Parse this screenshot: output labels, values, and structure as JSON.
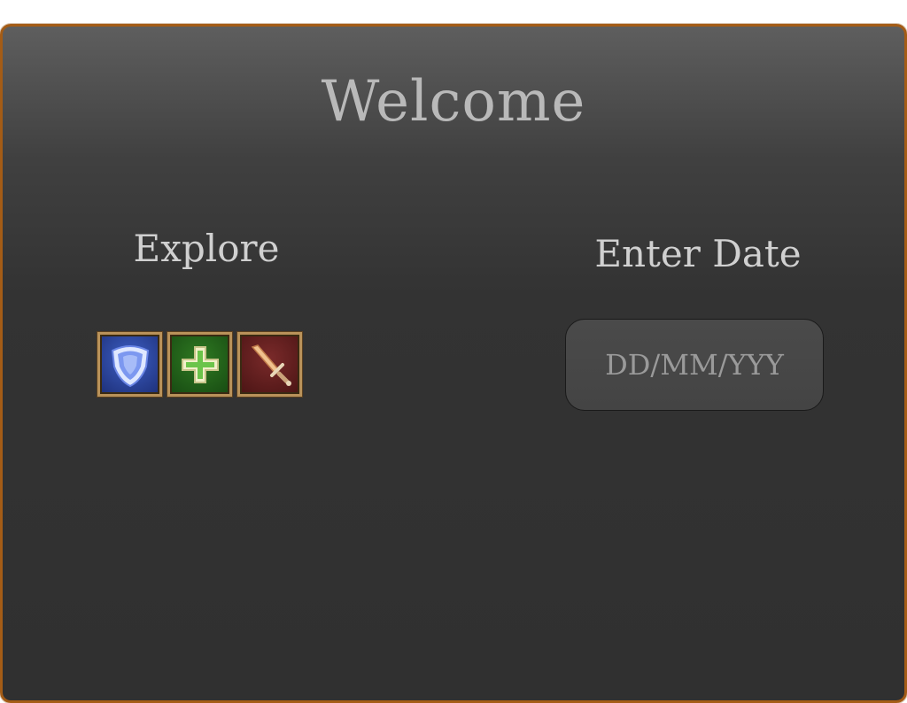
{
  "page": {
    "title": "Welcome"
  },
  "explore": {
    "label": "Explore",
    "icons": [
      {
        "name": "shield-icon",
        "color": "#2c46a8"
      },
      {
        "name": "healing-cross-icon",
        "color": "#2f7a22"
      },
      {
        "name": "sword-icon",
        "color": "#6a2222"
      }
    ]
  },
  "date": {
    "label": "Enter Date",
    "placeholder": "DD/MM/YYY",
    "value": ""
  },
  "colors": {
    "border": "#a45c16",
    "background": "#333333",
    "text": "#d0d0d0"
  }
}
